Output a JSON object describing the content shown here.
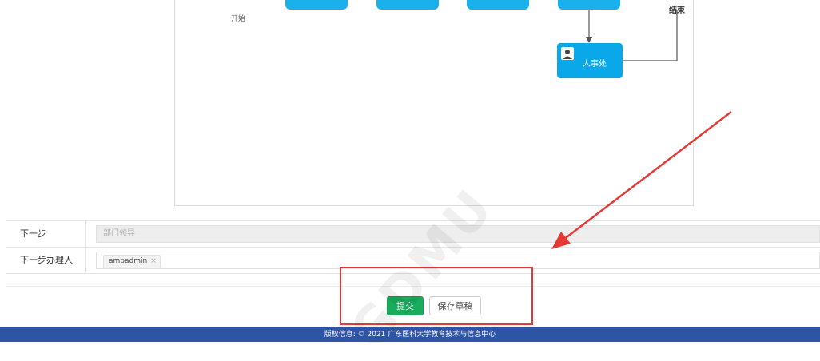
{
  "diagram": {
    "start_label": "开始",
    "end_label": "结束",
    "hr_node_label": "人事处"
  },
  "form": {
    "next_step_label": "下一步",
    "next_step_value": "部门领导",
    "next_handler_label": "下一步办理人",
    "handler_tag": "ampadmin",
    "tag_remove": "×"
  },
  "actions": {
    "submit_label": "提交",
    "save_draft_label": "保存草稿"
  },
  "footer": {
    "copyright": "版权信息: © 2021 广东医科大学教育技术与信息中心"
  },
  "watermark": "GDMU",
  "colors": {
    "node_blue": "#1ab0ec",
    "submit_green": "#1aab5c",
    "footer_blue": "#2d55a6",
    "annotation_red": "#e53935"
  }
}
